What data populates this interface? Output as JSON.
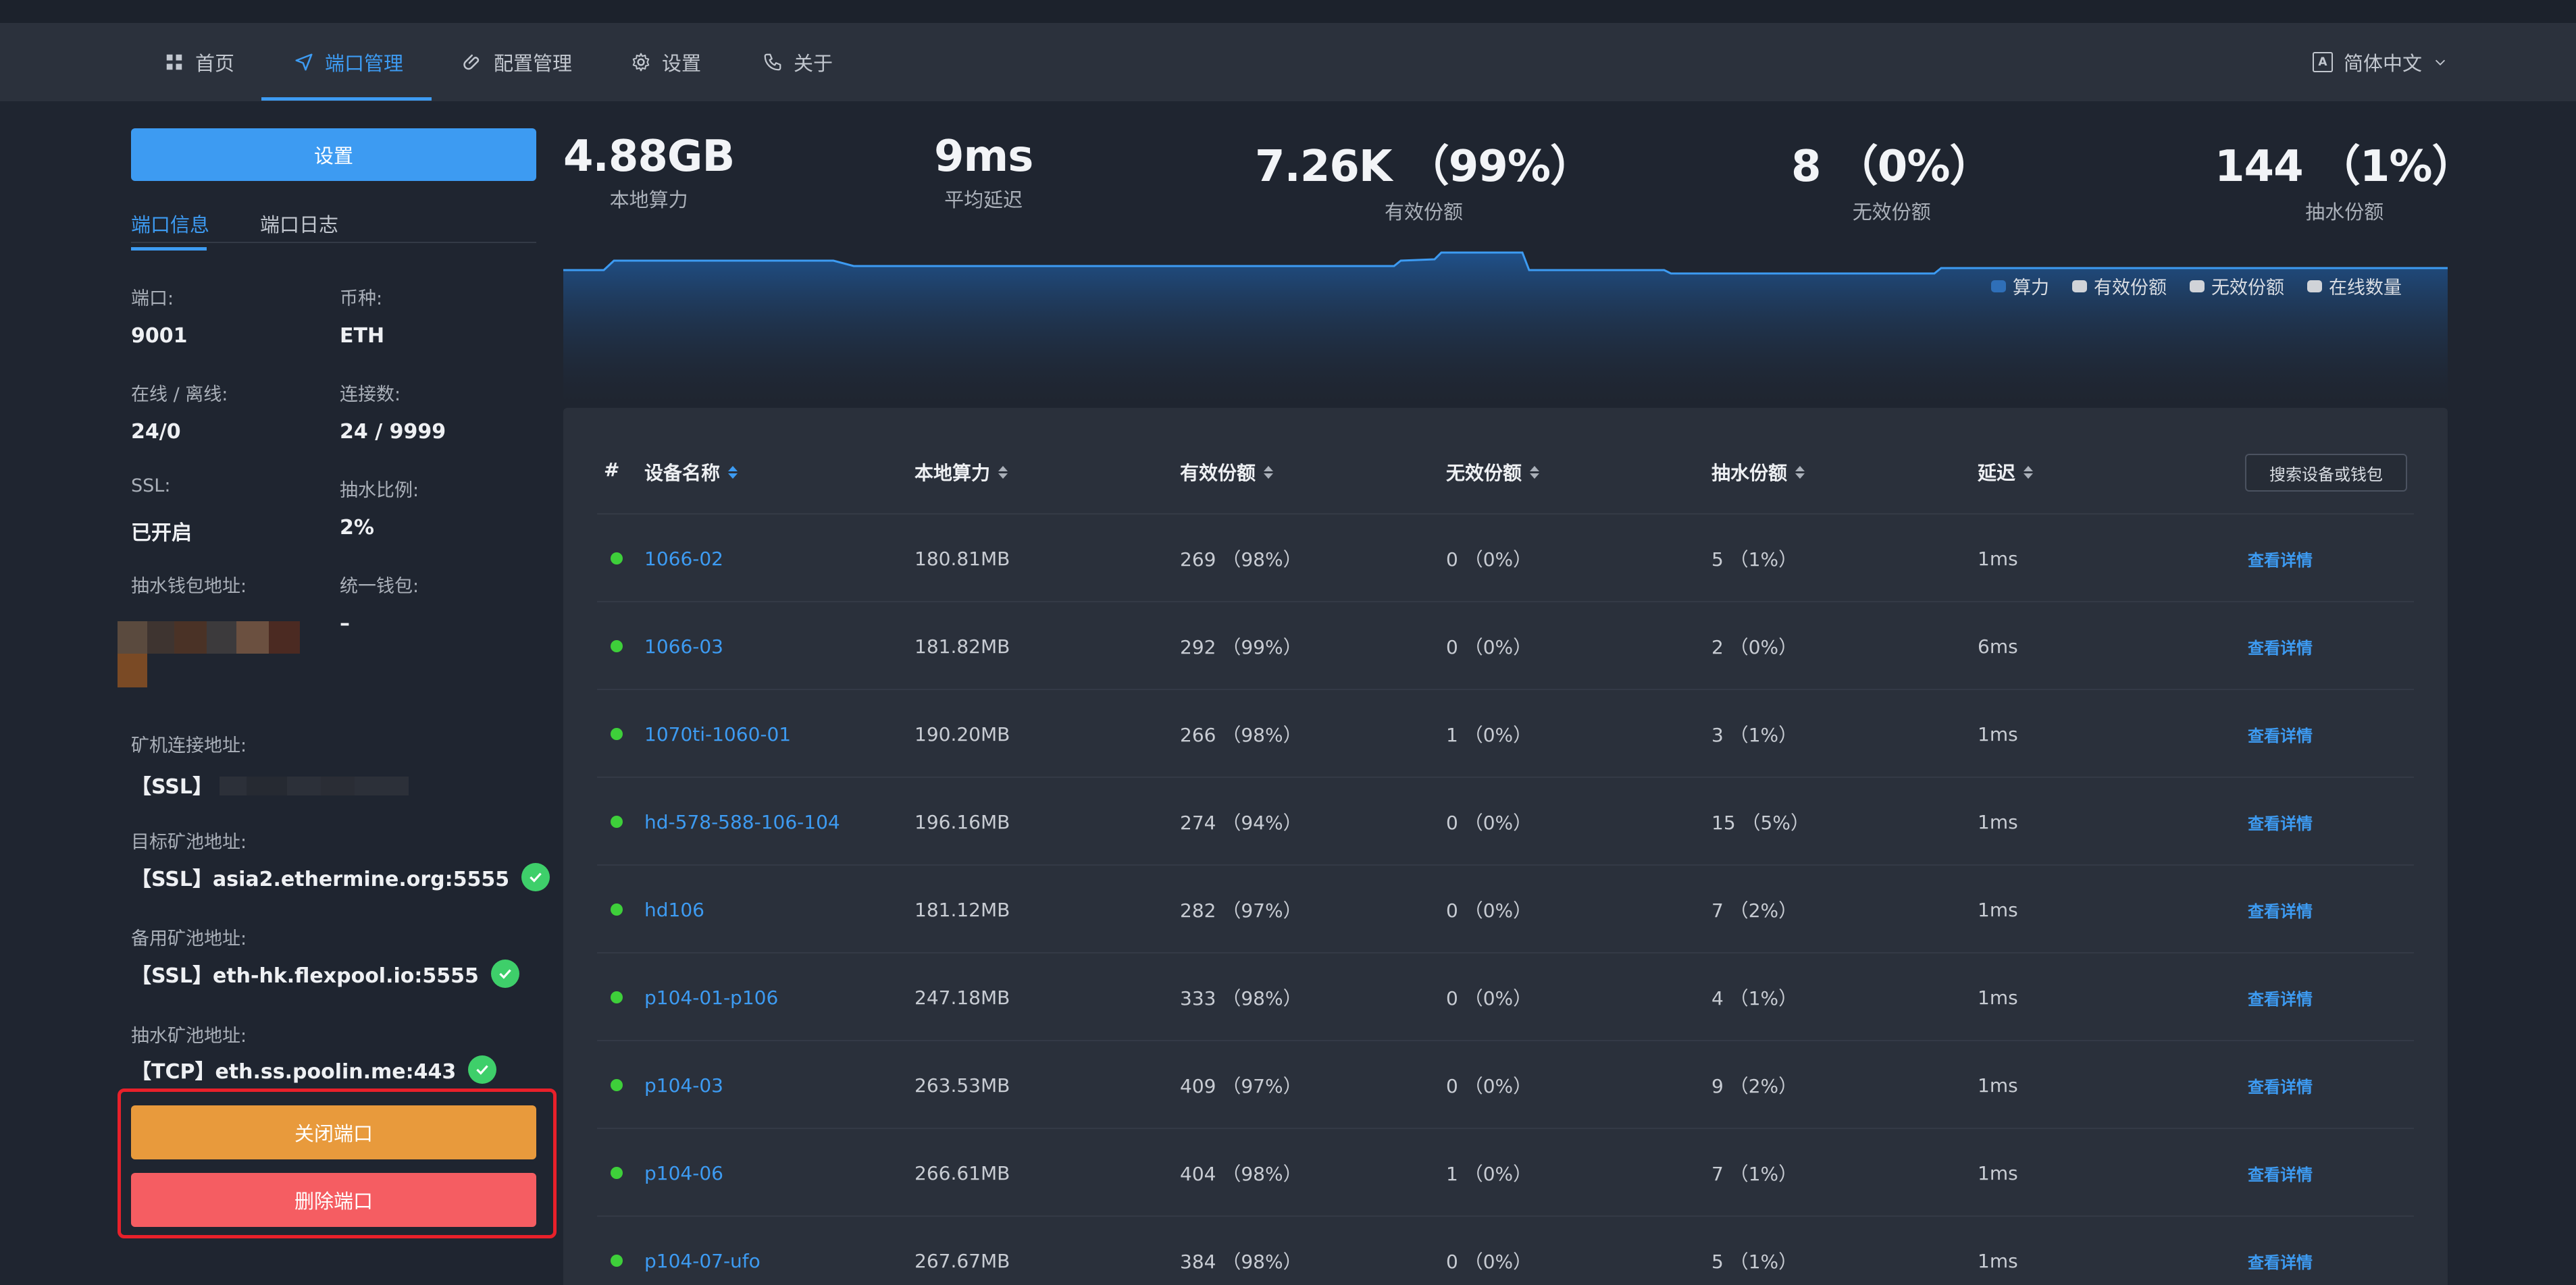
{
  "nav": {
    "items": [
      {
        "label": "首页",
        "icon": "grid-icon"
      },
      {
        "label": "端口管理",
        "icon": "send-icon"
      },
      {
        "label": "配置管理",
        "icon": "paperclip-icon"
      },
      {
        "label": "设置",
        "icon": "gear-icon"
      },
      {
        "label": "关于",
        "icon": "phone-icon"
      }
    ],
    "active_index": 1,
    "language": "简体中文"
  },
  "left": {
    "settings_button": "设置",
    "tabs": [
      "端口信息",
      "端口日志"
    ],
    "port_label": "端口:",
    "port_value": "9001",
    "coin_label": "币种:",
    "coin_value": "ETH",
    "online_label": "在线 / 离线:",
    "online_value": "24/0",
    "conn_label": "连接数:",
    "conn_value": "24 / 9999",
    "ssl_label": "SSL:",
    "ssl_value": "已开启",
    "ratio_label": "抽水比例:",
    "ratio_value": "2%",
    "fee_wallet_label": "抽水钱包地址:",
    "unified_wallet_label": "统一钱包:",
    "unified_wallet_value": "–",
    "miner_addr_label": "矿机连接地址:",
    "miner_addr_value": "【SSL】",
    "target_pool_label": "目标矿池地址:",
    "target_pool_value": "【SSL】asia2.ethermine.org:5555",
    "backup_pool_label": "备用矿池地址:",
    "backup_pool_value": "【SSL】eth-hk.flexpool.io:5555",
    "fee_pool_label": "抽水矿池地址:",
    "fee_pool_value": "【TCP】eth.ss.poolin.me:443",
    "close_button": "关闭端口",
    "delete_button": "删除端口"
  },
  "stats": [
    {
      "value": "4.88GB",
      "label": "本地算力"
    },
    {
      "value": "9ms",
      "label": "平均延迟"
    },
    {
      "value": "7.26K （99%）",
      "label": "有效份额"
    },
    {
      "value": "8 （0%）",
      "label": "无效份额"
    },
    {
      "value": "144 （1%）",
      "label": "抽水份额"
    }
  ],
  "legend": [
    {
      "label": "算力",
      "color": "#2f6fb8"
    },
    {
      "label": "有效份额",
      "color": "#d0d3d8"
    },
    {
      "label": "无效份额",
      "color": "#d0d3d8"
    },
    {
      "label": "在线数量",
      "color": "#d0d3d8"
    }
  ],
  "table": {
    "headers": [
      "#",
      "设备名称",
      "本地算力",
      "有效份额",
      "无效份额",
      "抽水份额",
      "延迟"
    ],
    "search_button": "搜索设备或钱包",
    "detail_label": "查看详情",
    "rows": [
      {
        "name": "1066-02",
        "hashrate": "180.81MB",
        "valid": "269 （98%）",
        "invalid": "0 （0%）",
        "fee": "5 （1%）",
        "latency": "1ms"
      },
      {
        "name": "1066-03",
        "hashrate": "181.82MB",
        "valid": "292 （99%）",
        "invalid": "0 （0%）",
        "fee": "2 （0%）",
        "latency": "6ms"
      },
      {
        "name": "1070ti-1060-01",
        "hashrate": "190.20MB",
        "valid": "266 （98%）",
        "invalid": "1 （0%）",
        "fee": "3 （1%）",
        "latency": "1ms"
      },
      {
        "name": "hd-578-588-106-104",
        "hashrate": "196.16MB",
        "valid": "274 （94%）",
        "invalid": "0 （0%）",
        "fee": "15 （5%）",
        "latency": "1ms"
      },
      {
        "name": "hd106",
        "hashrate": "181.12MB",
        "valid": "282 （97%）",
        "invalid": "0 （0%）",
        "fee": "7 （2%）",
        "latency": "1ms"
      },
      {
        "name": "p104-01-p106",
        "hashrate": "247.18MB",
        "valid": "333 （98%）",
        "invalid": "0 （0%）",
        "fee": "4 （1%）",
        "latency": "1ms"
      },
      {
        "name": "p104-03",
        "hashrate": "263.53MB",
        "valid": "409 （97%）",
        "invalid": "0 （0%）",
        "fee": "9 （2%）",
        "latency": "1ms"
      },
      {
        "name": "p104-06",
        "hashrate": "266.61MB",
        "valid": "404 （98%）",
        "invalid": "1 （0%）",
        "fee": "7 （1%）",
        "latency": "1ms"
      },
      {
        "name": "p104-07-ufo",
        "hashrate": "267.67MB",
        "valid": "384 （98%）",
        "invalid": "0 （0%）",
        "fee": "5 （1%）",
        "latency": "1ms"
      }
    ]
  }
}
